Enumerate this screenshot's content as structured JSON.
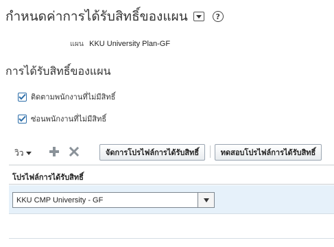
{
  "page": {
    "title": "กำหนดค่าการได้รับสิทธิ์ของแผน",
    "title_menu_icon": "chevron-down-icon",
    "help_icon": "question-circle-icon",
    "help_glyph": "?"
  },
  "plan": {
    "label": "แผน",
    "value": "KKU University Plan-GF"
  },
  "section": {
    "title": "การได้รับสิทธิ์ของแผน"
  },
  "options": {
    "track_ineligible": {
      "label": "ติดตามพนักงานที่ไม่มีสิทธิ์",
      "checked": true
    },
    "hide_ineligible": {
      "label": "ซ่อนพนักงานที่ไม่มีสิทธิ์",
      "checked": true
    }
  },
  "toolbar": {
    "view_label": "วิว",
    "add_icon": "plus-icon",
    "delete_icon": "x-icon",
    "manage_button": "จัดการโปรไฟล์การได้รับสิทธิ์",
    "test_button": "ทดสอบโปรไฟล์การได้รับสิทธิ์"
  },
  "table": {
    "column_header": "โปรไฟล์การได้รับสิทธิ์",
    "rows": [
      {
        "profile": "KKU CMP University - GF"
      }
    ]
  },
  "colors": {
    "accent": "#2d6ea9",
    "selected_row": "#e6f1fa",
    "icon_gray": "#8a9299"
  }
}
